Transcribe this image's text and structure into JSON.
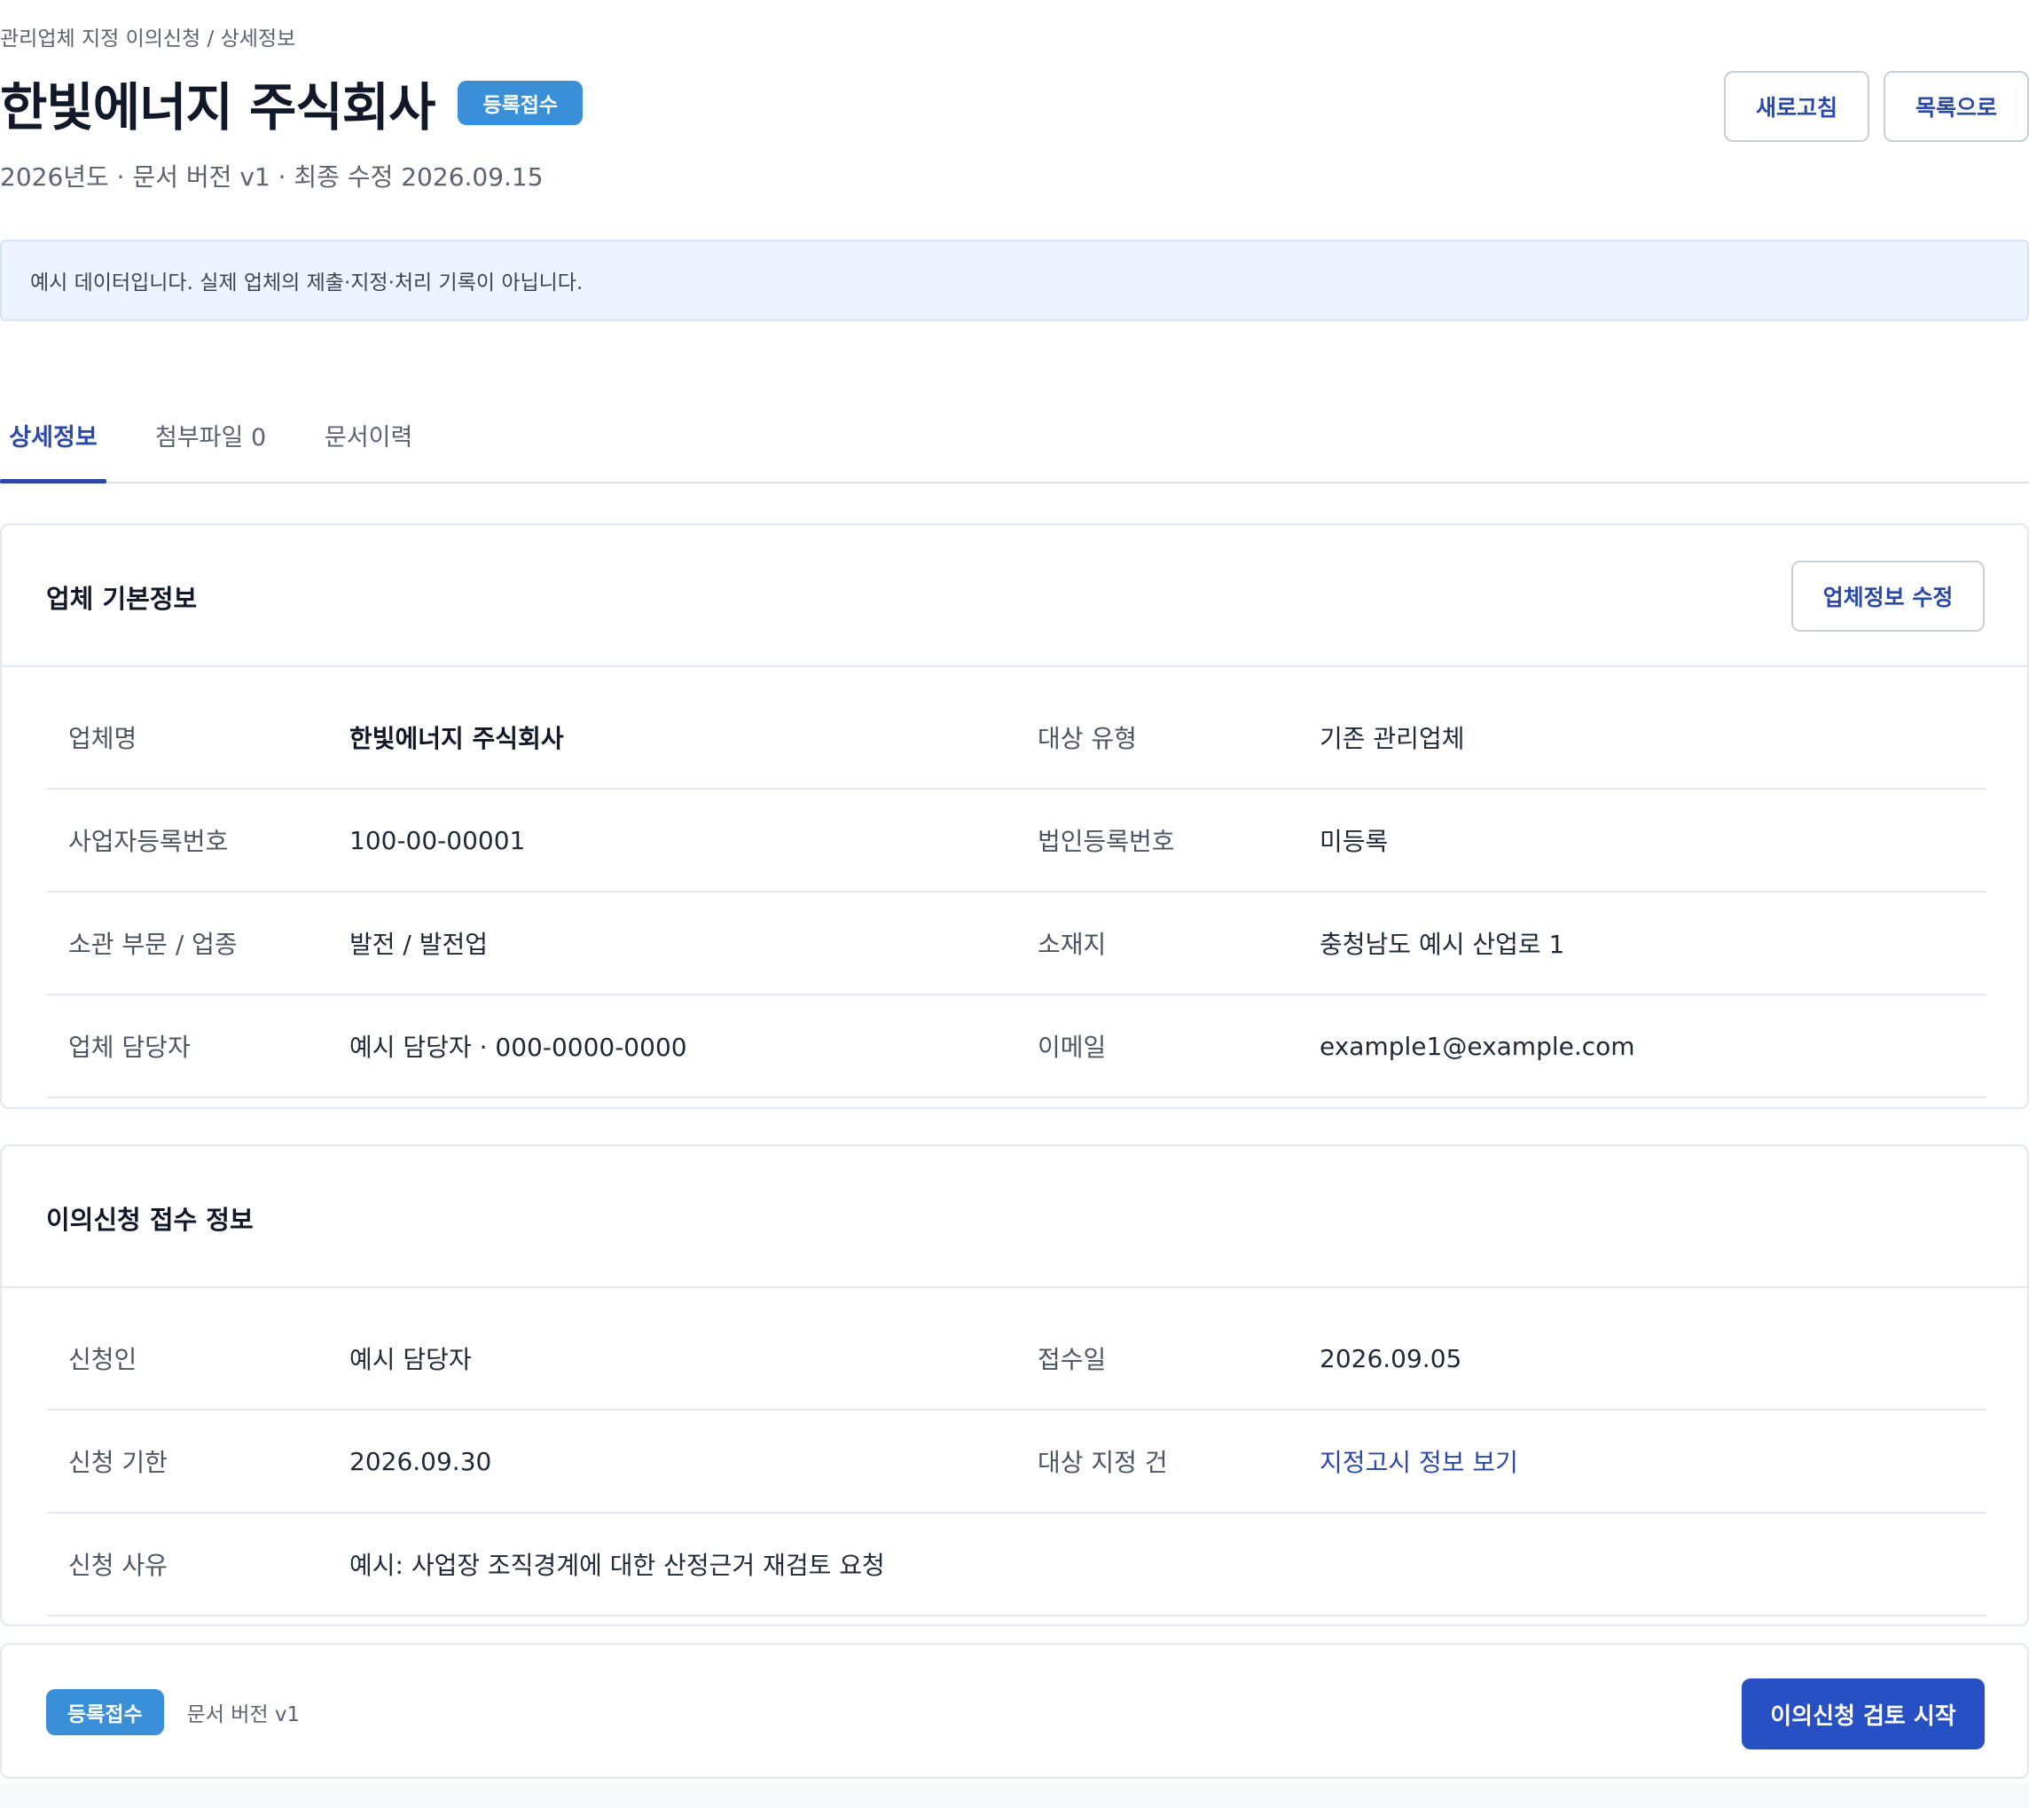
{
  "breadcrumb": "관리업체 지정 이의신청 / 상세정보",
  "header": {
    "title": "한빛에너지 주식회사",
    "status_badge": "등록접수",
    "meta": "2026년도 · 문서 버전 v1 · 최종 수정 2026.09.15",
    "refresh_label": "새로고침",
    "list_label": "목록으로"
  },
  "notice": "예시 데이터입니다. 실제 업체의 제출·지정·처리 기록이 아닙니다.",
  "tabs": [
    {
      "label": "상세정보",
      "active": true
    },
    {
      "label": "첨부파일 0",
      "active": false
    },
    {
      "label": "문서이력",
      "active": false
    }
  ],
  "company_card": {
    "title": "업체 기본정보",
    "edit_label": "업체정보 수정",
    "rows": [
      {
        "label1": "업체명",
        "value1": "한빛에너지 주식회사",
        "label2": "대상 유형",
        "value2": "기존 관리업체"
      },
      {
        "label1": "사업자등록번호",
        "value1": "100-00-00001",
        "label2": "법인등록번호",
        "value2": "미등록"
      },
      {
        "label1": "소관 부문 / 업종",
        "value1": "발전 / 발전업",
        "label2": "소재지",
        "value2": "충청남도 예시 산업로 1"
      },
      {
        "label1": "업체 담당자",
        "value1": "예시 담당자 · 000-0000-0000",
        "label2": "이메일",
        "value2": "example1@example.com"
      }
    ]
  },
  "objection_card": {
    "title": "이의신청 접수 정보",
    "rows": [
      {
        "label1": "신청인",
        "value1": "예시 담당자",
        "label2": "접수일",
        "value2": "2026.09.05"
      },
      {
        "label1": "신청 기한",
        "value1": "2026.09.30",
        "label2": "대상 지정 건",
        "value2": "지정고시 정보 보기"
      },
      {
        "label1": "신청 사유",
        "value1": "예시: 사업장 조직경계에 대한 산정근거 재검토 요청"
      }
    ]
  },
  "footer": {
    "status_badge": "등록접수",
    "version": "문서 버전 v1",
    "primary_action": "이의신청 검토 시작"
  },
  "colors": {
    "accent": "#2b4aa8",
    "primary_button": "#2650c4",
    "badge": "#3a8fd9",
    "notice_bg": "#eef4ff"
  }
}
